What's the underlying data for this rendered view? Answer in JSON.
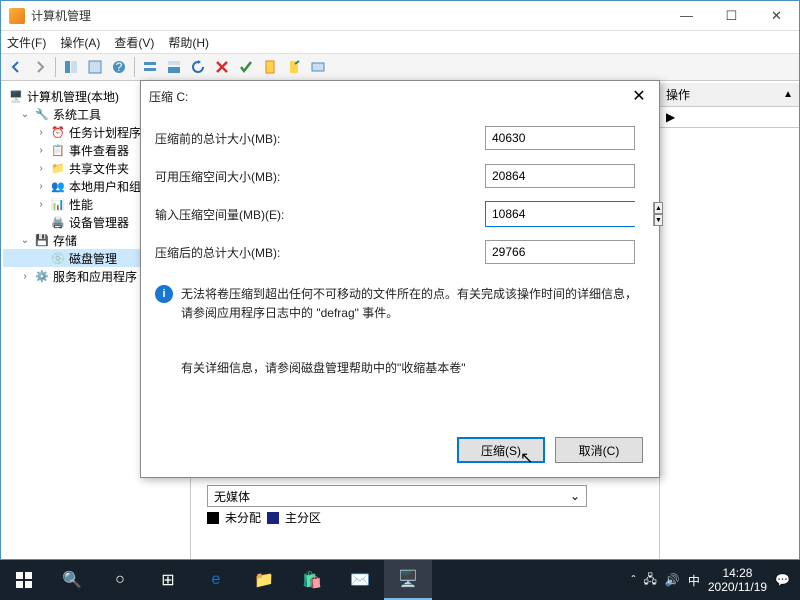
{
  "window": {
    "title": "计算机管理"
  },
  "menu": {
    "file": "文件(F)",
    "action": "操作(A)",
    "view": "查看(V)",
    "help": "帮助(H)"
  },
  "tree": {
    "root": "计算机管理(本地)",
    "systools": "系统工具",
    "scheduler": "任务计划程序",
    "eventviewer": "事件查看器",
    "sharedfolders": "共享文件夹",
    "localusers": "本地用户和组",
    "performance": "性能",
    "devmgr": "设备管理器",
    "storage": "存储",
    "diskmgmt": "磁盘管理",
    "services": "服务和应用程序"
  },
  "actions_pane": {
    "header": "操作"
  },
  "dropdown": {
    "text": "无媒体"
  },
  "legend": {
    "unallocated": "未分配",
    "primary": "主分区"
  },
  "dialog": {
    "title": "压缩 C:",
    "before_label": "压缩前的总计大小(MB):",
    "before_value": "40630",
    "avail_label": "可用压缩空间大小(MB):",
    "avail_value": "20864",
    "input_label": "输入压缩空间量(MB)(E):",
    "input_value": "10864",
    "after_label": "压缩后的总计大小(MB):",
    "after_value": "29766",
    "info1": "无法将卷压缩到超出任何不可移动的文件所在的点。有关完成该操作时间的详细信息，请参阅应用程序日志中的 \"defrag\" 事件。",
    "info2": "有关详细信息，请参阅磁盘管理帮助中的\"收缩基本卷\"",
    "shrink_btn": "压缩(S)",
    "cancel_btn": "取消(C)"
  },
  "taskbar": {
    "ime": "中",
    "time": "14:28",
    "date": "2020/11/19"
  }
}
